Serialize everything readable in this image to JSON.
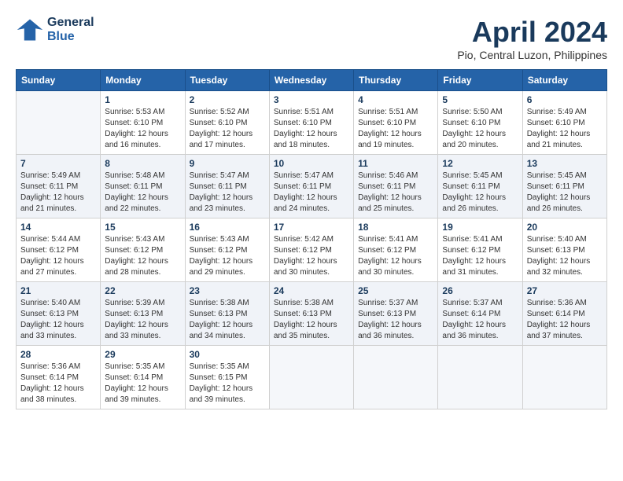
{
  "logo": {
    "line1": "General",
    "line2": "Blue"
  },
  "title": "April 2024",
  "subtitle": "Pio, Central Luzon, Philippines",
  "days_of_week": [
    "Sunday",
    "Monday",
    "Tuesday",
    "Wednesday",
    "Thursday",
    "Friday",
    "Saturday"
  ],
  "weeks": [
    [
      {
        "day": "",
        "info": ""
      },
      {
        "day": "1",
        "info": "Sunrise: 5:53 AM\nSunset: 6:10 PM\nDaylight: 12 hours\nand 16 minutes."
      },
      {
        "day": "2",
        "info": "Sunrise: 5:52 AM\nSunset: 6:10 PM\nDaylight: 12 hours\nand 17 minutes."
      },
      {
        "day": "3",
        "info": "Sunrise: 5:51 AM\nSunset: 6:10 PM\nDaylight: 12 hours\nand 18 minutes."
      },
      {
        "day": "4",
        "info": "Sunrise: 5:51 AM\nSunset: 6:10 PM\nDaylight: 12 hours\nand 19 minutes."
      },
      {
        "day": "5",
        "info": "Sunrise: 5:50 AM\nSunset: 6:10 PM\nDaylight: 12 hours\nand 20 minutes."
      },
      {
        "day": "6",
        "info": "Sunrise: 5:49 AM\nSunset: 6:10 PM\nDaylight: 12 hours\nand 21 minutes."
      }
    ],
    [
      {
        "day": "7",
        "info": "Sunrise: 5:49 AM\nSunset: 6:11 PM\nDaylight: 12 hours\nand 21 minutes."
      },
      {
        "day": "8",
        "info": "Sunrise: 5:48 AM\nSunset: 6:11 PM\nDaylight: 12 hours\nand 22 minutes."
      },
      {
        "day": "9",
        "info": "Sunrise: 5:47 AM\nSunset: 6:11 PM\nDaylight: 12 hours\nand 23 minutes."
      },
      {
        "day": "10",
        "info": "Sunrise: 5:47 AM\nSunset: 6:11 PM\nDaylight: 12 hours\nand 24 minutes."
      },
      {
        "day": "11",
        "info": "Sunrise: 5:46 AM\nSunset: 6:11 PM\nDaylight: 12 hours\nand 25 minutes."
      },
      {
        "day": "12",
        "info": "Sunrise: 5:45 AM\nSunset: 6:11 PM\nDaylight: 12 hours\nand 26 minutes."
      },
      {
        "day": "13",
        "info": "Sunrise: 5:45 AM\nSunset: 6:11 PM\nDaylight: 12 hours\nand 26 minutes."
      }
    ],
    [
      {
        "day": "14",
        "info": "Sunrise: 5:44 AM\nSunset: 6:12 PM\nDaylight: 12 hours\nand 27 minutes."
      },
      {
        "day": "15",
        "info": "Sunrise: 5:43 AM\nSunset: 6:12 PM\nDaylight: 12 hours\nand 28 minutes."
      },
      {
        "day": "16",
        "info": "Sunrise: 5:43 AM\nSunset: 6:12 PM\nDaylight: 12 hours\nand 29 minutes."
      },
      {
        "day": "17",
        "info": "Sunrise: 5:42 AM\nSunset: 6:12 PM\nDaylight: 12 hours\nand 30 minutes."
      },
      {
        "day": "18",
        "info": "Sunrise: 5:41 AM\nSunset: 6:12 PM\nDaylight: 12 hours\nand 30 minutes."
      },
      {
        "day": "19",
        "info": "Sunrise: 5:41 AM\nSunset: 6:12 PM\nDaylight: 12 hours\nand 31 minutes."
      },
      {
        "day": "20",
        "info": "Sunrise: 5:40 AM\nSunset: 6:13 PM\nDaylight: 12 hours\nand 32 minutes."
      }
    ],
    [
      {
        "day": "21",
        "info": "Sunrise: 5:40 AM\nSunset: 6:13 PM\nDaylight: 12 hours\nand 33 minutes."
      },
      {
        "day": "22",
        "info": "Sunrise: 5:39 AM\nSunset: 6:13 PM\nDaylight: 12 hours\nand 33 minutes."
      },
      {
        "day": "23",
        "info": "Sunrise: 5:38 AM\nSunset: 6:13 PM\nDaylight: 12 hours\nand 34 minutes."
      },
      {
        "day": "24",
        "info": "Sunrise: 5:38 AM\nSunset: 6:13 PM\nDaylight: 12 hours\nand 35 minutes."
      },
      {
        "day": "25",
        "info": "Sunrise: 5:37 AM\nSunset: 6:13 PM\nDaylight: 12 hours\nand 36 minutes."
      },
      {
        "day": "26",
        "info": "Sunrise: 5:37 AM\nSunset: 6:14 PM\nDaylight: 12 hours\nand 36 minutes."
      },
      {
        "day": "27",
        "info": "Sunrise: 5:36 AM\nSunset: 6:14 PM\nDaylight: 12 hours\nand 37 minutes."
      }
    ],
    [
      {
        "day": "28",
        "info": "Sunrise: 5:36 AM\nSunset: 6:14 PM\nDaylight: 12 hours\nand 38 minutes."
      },
      {
        "day": "29",
        "info": "Sunrise: 5:35 AM\nSunset: 6:14 PM\nDaylight: 12 hours\nand 39 minutes."
      },
      {
        "day": "30",
        "info": "Sunrise: 5:35 AM\nSunset: 6:15 PM\nDaylight: 12 hours\nand 39 minutes."
      },
      {
        "day": "",
        "info": ""
      },
      {
        "day": "",
        "info": ""
      },
      {
        "day": "",
        "info": ""
      },
      {
        "day": "",
        "info": ""
      }
    ]
  ]
}
